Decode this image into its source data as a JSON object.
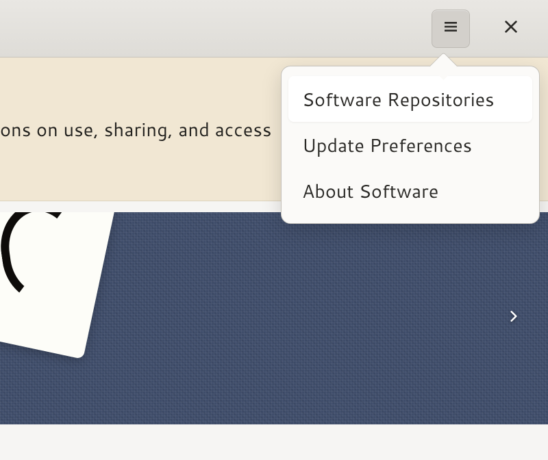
{
  "infobar": {
    "text": "ons on use, sharing, and access"
  },
  "menu": {
    "items": [
      {
        "label": "Software Repositories"
      },
      {
        "label": "Update Preferences"
      },
      {
        "label": "About Software"
      }
    ]
  }
}
